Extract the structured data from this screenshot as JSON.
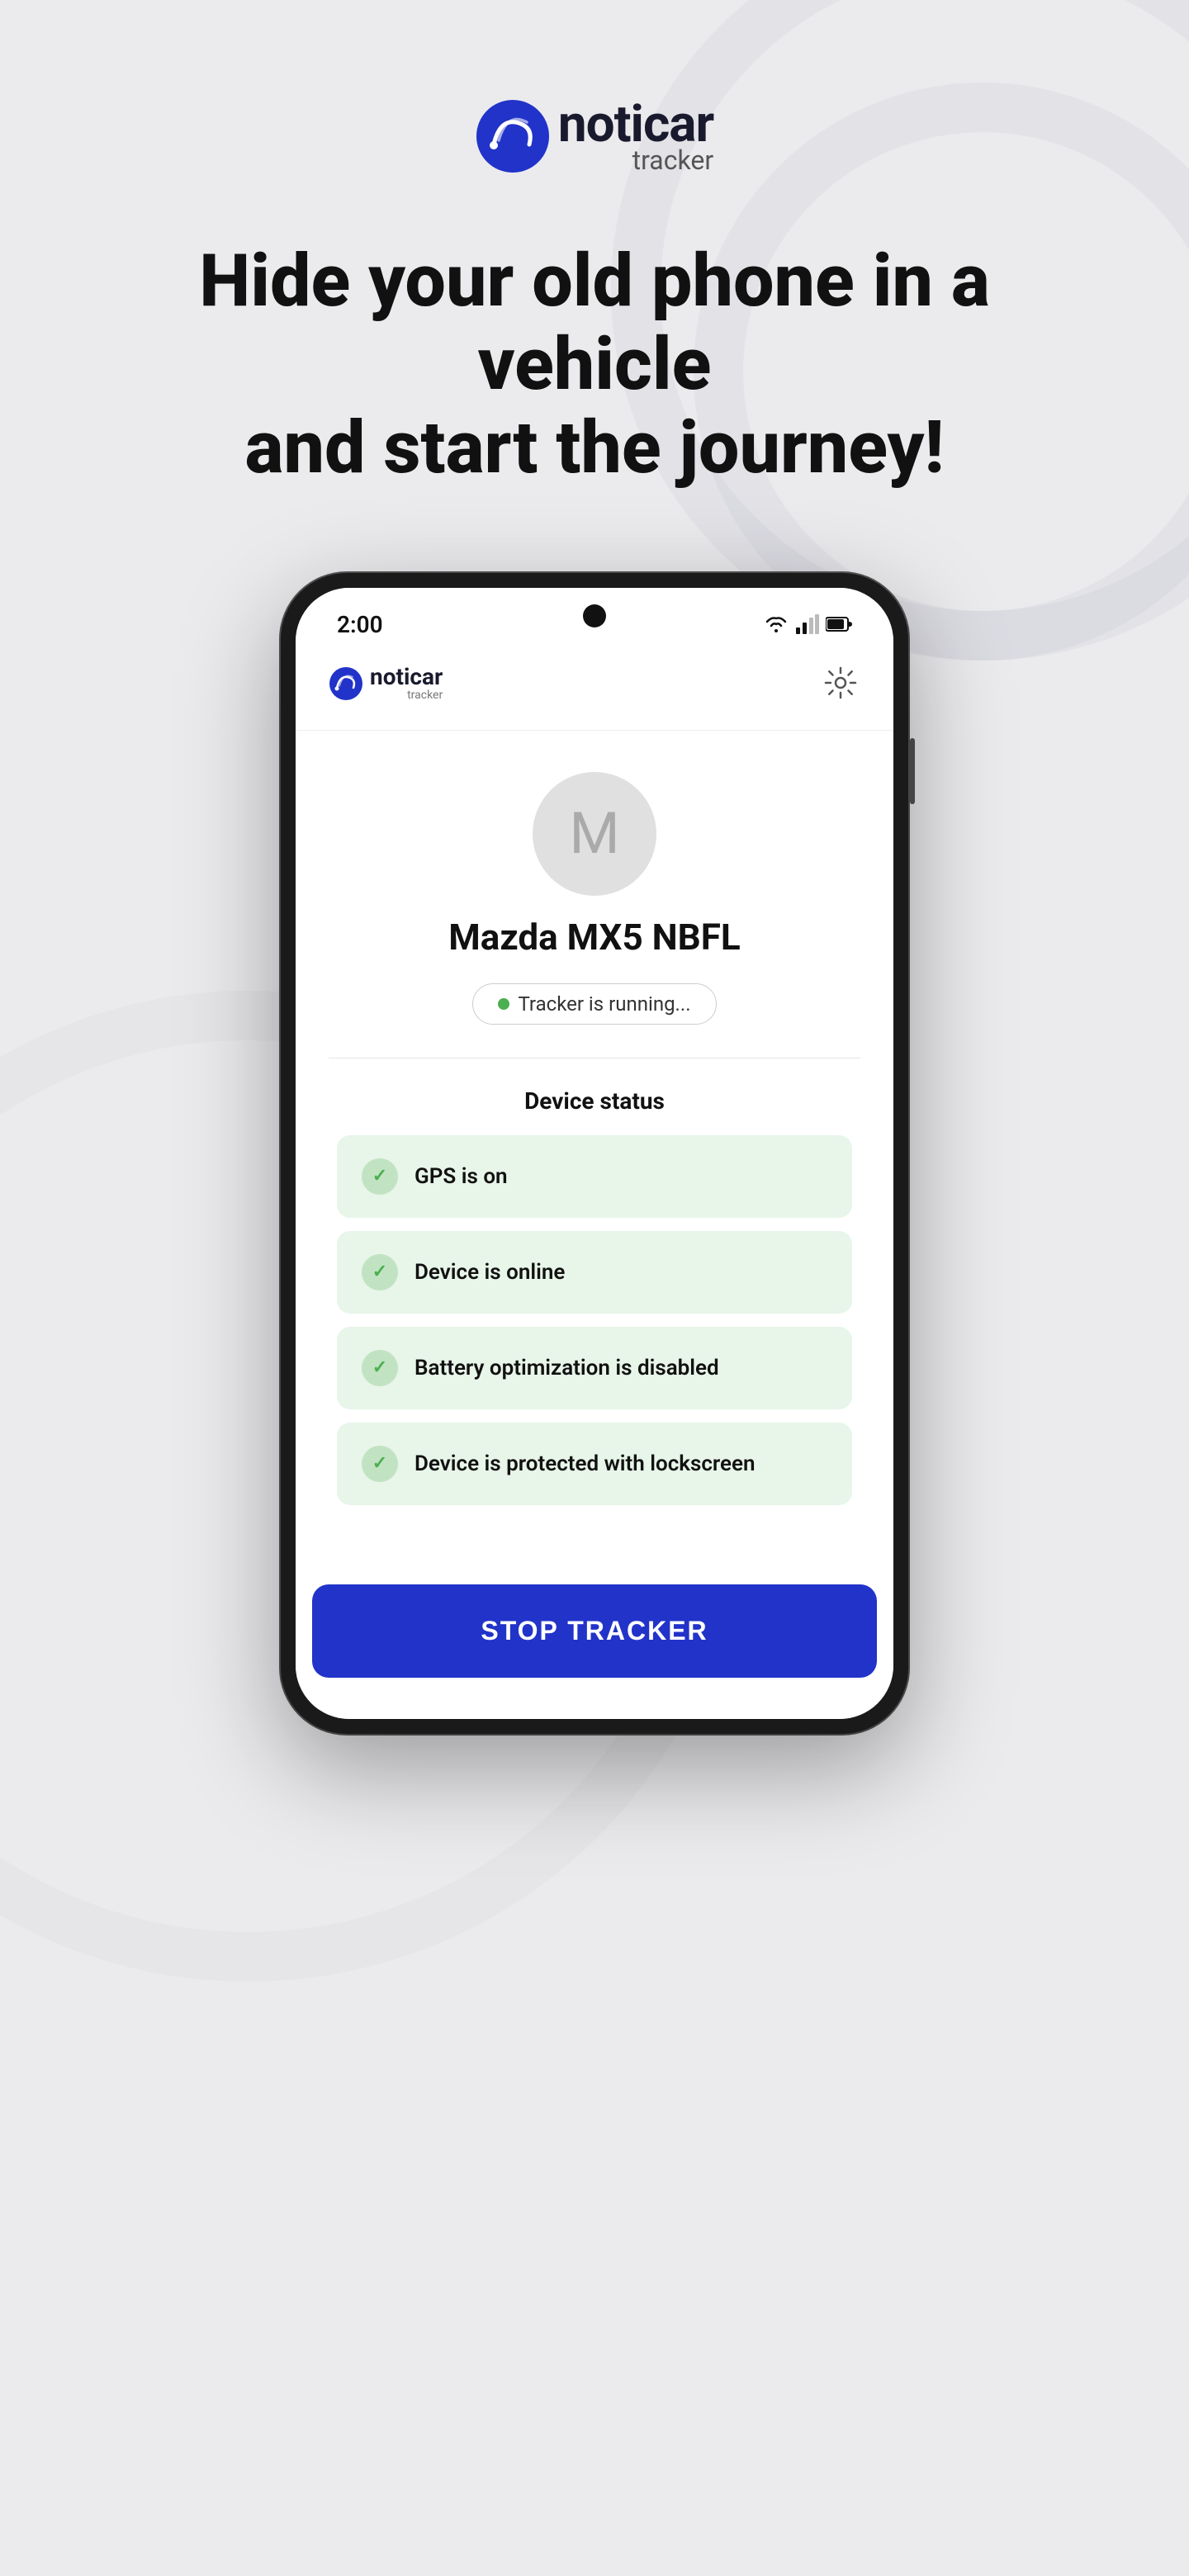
{
  "page": {
    "background_color": "#ebebee"
  },
  "top_logo": {
    "noticar": "noticar",
    "tracker": "tracker"
  },
  "hero": {
    "line1": "Hide your old phone in a vehicle",
    "line2": "and start the journey!"
  },
  "phone": {
    "status_bar": {
      "time": "2:00"
    },
    "app_header": {
      "logo_noticar": "noticar",
      "logo_tracker": "tracker"
    },
    "avatar": {
      "letter": "M",
      "vehicle_name": "Mazda MX5 NBFL"
    },
    "tracker_status": {
      "text": "Tracker is running..."
    },
    "device_status": {
      "title": "Device status",
      "items": [
        {
          "text": "GPS is on"
        },
        {
          "text": "Device is online"
        },
        {
          "text": "Battery optimization is disabled"
        },
        {
          "text": "Device is protected with lockscreen"
        }
      ]
    },
    "stop_button": {
      "label": "STOP TRACKER"
    }
  }
}
